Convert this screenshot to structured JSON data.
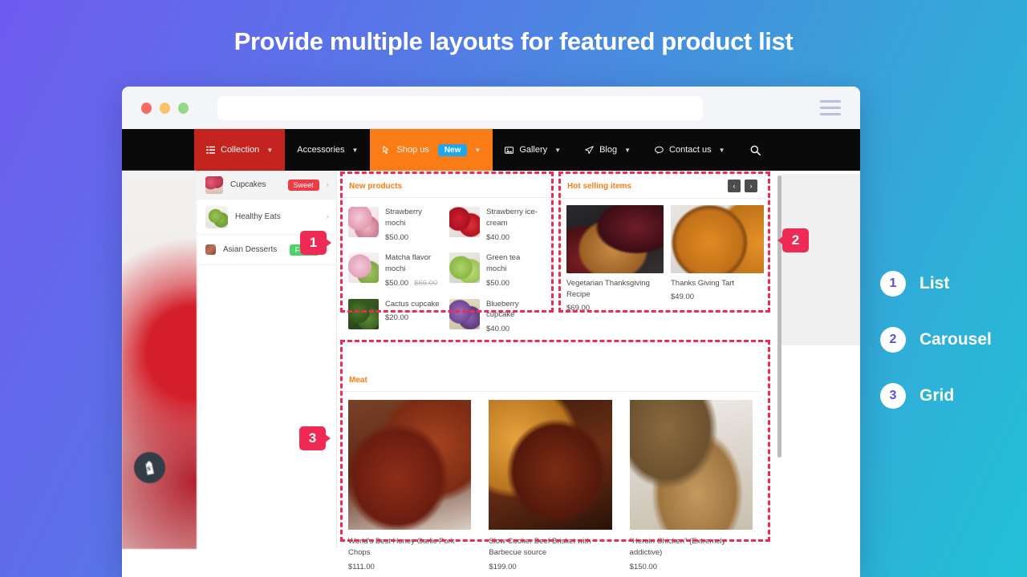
{
  "page": {
    "title": "Provide multiple layouts for featured product list",
    "accent_pink": "#ef2b55",
    "accent_orange": "#fa7c16",
    "bg_gradient_from": "#6f5bf0",
    "bg_gradient_to": "#22c1d6"
  },
  "browser": {
    "url_value": "",
    "url_placeholder": "",
    "menu_icon": "hamburger-icon",
    "lights": [
      "close-red",
      "minimize-yellow",
      "maximize-green"
    ]
  },
  "site_nav": {
    "items": [
      {
        "label": "Collection",
        "icon": "list-icon",
        "caret": "⌄",
        "style": "red",
        "badge": ""
      },
      {
        "label": "Accessories",
        "icon": "",
        "caret": "⌄",
        "style": "plain",
        "badge": ""
      },
      {
        "label": "Shop us",
        "icon": "cursor-icon",
        "caret": "⌄",
        "style": "orange",
        "badge": "New"
      },
      {
        "label": "Gallery",
        "icon": "image-icon",
        "caret": "⌄",
        "style": "plain",
        "badge": ""
      },
      {
        "label": "Blog",
        "icon": "paper-plane-icon",
        "caret": "⌄",
        "style": "plain",
        "badge": ""
      },
      {
        "label": "Contact us",
        "icon": "chat-icon",
        "caret": "⌄",
        "style": "plain",
        "badge": ""
      }
    ],
    "search_icon": "search-icon"
  },
  "sidebar": {
    "items": [
      {
        "label": "Cupcakes",
        "badge": "Sweet",
        "badge_color": "#ef3b45",
        "chevron": "›"
      },
      {
        "label": "Healthy Eats",
        "badge": "",
        "badge_color": "",
        "chevron": "›"
      },
      {
        "label": "Asian Desserts",
        "badge": "Fresh",
        "badge_color": "#4fd26b",
        "chevron": "›"
      }
    ]
  },
  "fab": {
    "name": "shopify-bag-icon"
  },
  "widgets": {
    "list": {
      "title": "New products",
      "products": [
        {
          "name": "Strawberry mochi",
          "price": "$50.00",
          "old_price": ""
        },
        {
          "name": "Strawberry ice-cream",
          "price": "$40.00",
          "old_price": ""
        },
        {
          "name": "Matcha flavor mochi",
          "price": "$50.00",
          "old_price": "$66.00"
        },
        {
          "name": "Green tea mochi",
          "price": "$50.00",
          "old_price": ""
        },
        {
          "name": "Cactus cupcake",
          "price": "$20.00",
          "old_price": ""
        },
        {
          "name": "Blueberry cupcake",
          "price": "$40.00",
          "old_price": ""
        }
      ]
    },
    "carousel": {
      "title": "Hot selling items",
      "prev_label": "‹",
      "next_label": "›",
      "products": [
        {
          "name": "Vegetarian Thanksgiving Recipe",
          "price": "$69.00"
        },
        {
          "name": "Thanks Giving Tart",
          "price": "$49.00"
        }
      ]
    },
    "grid": {
      "title": "Meat",
      "products": [
        {
          "name": "World's Best Honey Garlic Pork Chops",
          "price": "$111.00"
        },
        {
          "name": "Slow Cooker Beef Brisket with Barbecue source",
          "price": "$199.00"
        },
        {
          "name": "\"Heroin Chicken\" (Extremely addictive)",
          "price": "$150.00"
        }
      ]
    }
  },
  "markers": [
    {
      "number": "1",
      "direction": "right"
    },
    {
      "number": "2",
      "direction": "left"
    },
    {
      "number": "3",
      "direction": "right"
    }
  ],
  "legend": {
    "rows": [
      {
        "number": "1",
        "label": "List"
      },
      {
        "number": "2",
        "label": "Carousel"
      },
      {
        "number": "3",
        "label": "Grid"
      }
    ]
  }
}
